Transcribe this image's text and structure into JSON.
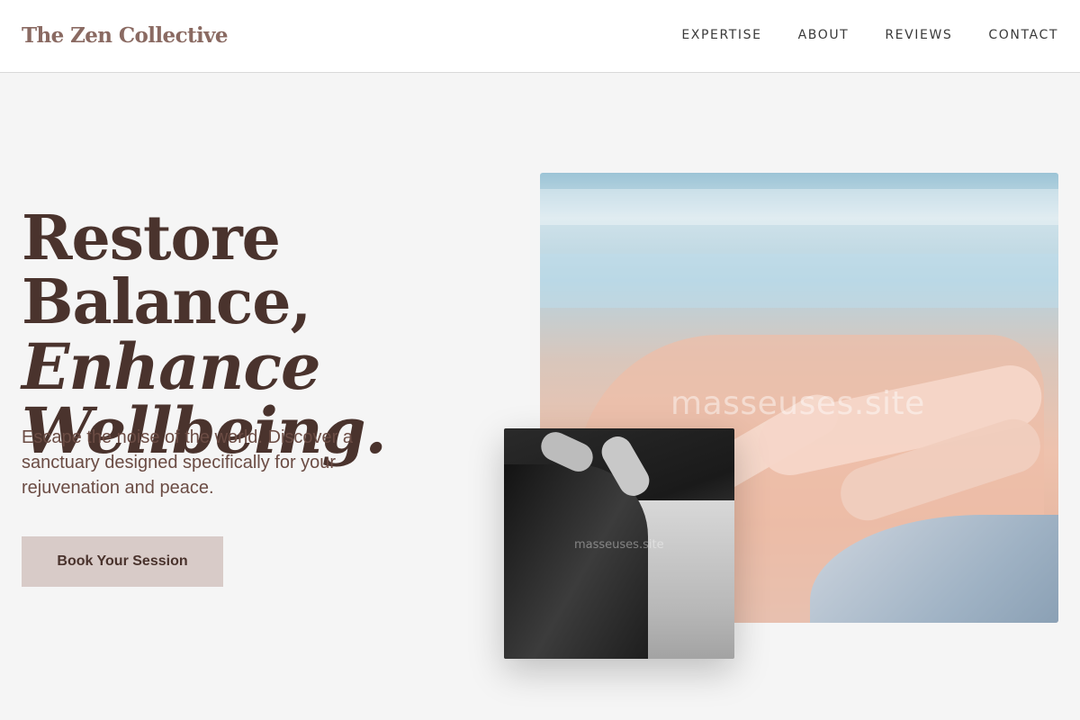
{
  "header": {
    "brand": "The Zen Collective",
    "nav": [
      "EXPERTISE",
      "ABOUT",
      "REVIEWS",
      "CONTACT"
    ]
  },
  "hero": {
    "headline_line1": "Restore Balance,",
    "headline_line2": "Enhance",
    "headline_line3": "Wellbeing.",
    "lede": "Escape the noise of the world. Discover a sanctuary designed specifically for your rejuvenation and peace.",
    "cta_label": "Book Your Session"
  },
  "images": {
    "main_watermark": "masseuses.site",
    "inset_watermark": "masseuses.site"
  },
  "colors": {
    "background": "#f5f5f5",
    "brand": "#8a6a62",
    "headline": "#4a332d",
    "button": "#d8cbc8"
  }
}
